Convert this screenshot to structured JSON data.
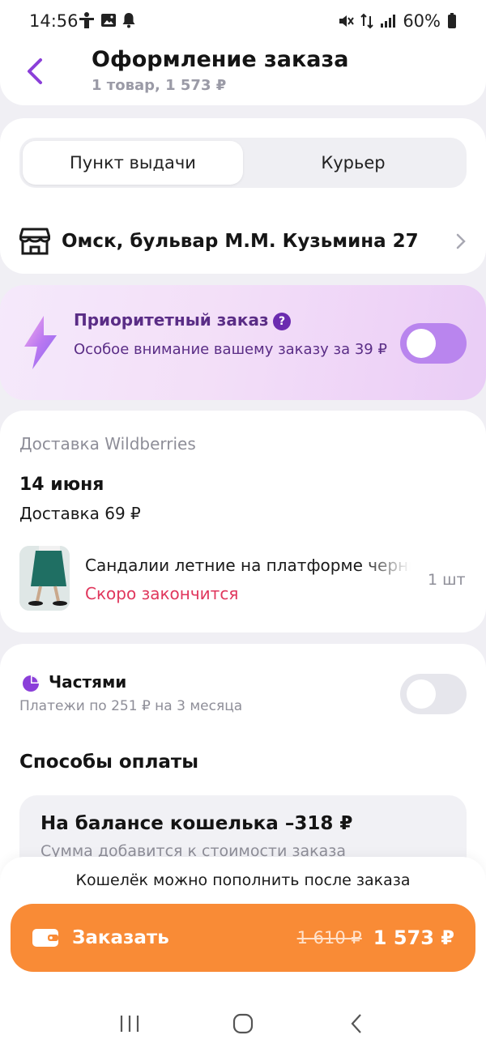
{
  "status_bar": {
    "time": "14:56",
    "battery": "60%"
  },
  "header": {
    "title": "Оформление заказа",
    "subtitle": "1 товар, 1 573 ₽"
  },
  "delivery_tabs": [
    {
      "label": "Пункт выдачи",
      "active": true
    },
    {
      "label": "Курьер",
      "active": false
    }
  ],
  "address": "Омск, бульвар М.М. Кузьмина 27",
  "priority": {
    "title": "Приоритетный заказ",
    "help": "?",
    "description": "Особое внимание вашему заказу за 39 ₽",
    "enabled": false
  },
  "delivery": {
    "source": "Доставка Wildberries",
    "date": "14 июня",
    "cost": "Доставка 69 ₽",
    "product": {
      "name": "Сандалии летние на платформе черные",
      "warning": "Скоро закончится",
      "quantity": "1 шт"
    }
  },
  "installments": {
    "title": "Частями",
    "description": "Платежи по 251 ₽ на 3 месяца",
    "enabled": false
  },
  "payment": {
    "section_title": "Способы оплаты",
    "wallet_title": "На балансе кошелька –318 ₽",
    "wallet_desc": "Сумма добавится к стоимости заказа"
  },
  "bottom": {
    "note": "Кошелёк можно пополнить после заказа",
    "order_label": "Заказать",
    "old_price": "1 610 ₽",
    "new_price": "1 573 ₽"
  },
  "colors": {
    "accent_purple": "#8b3fd9",
    "order_orange": "#f98b36",
    "warning_red": "#e0365c"
  }
}
